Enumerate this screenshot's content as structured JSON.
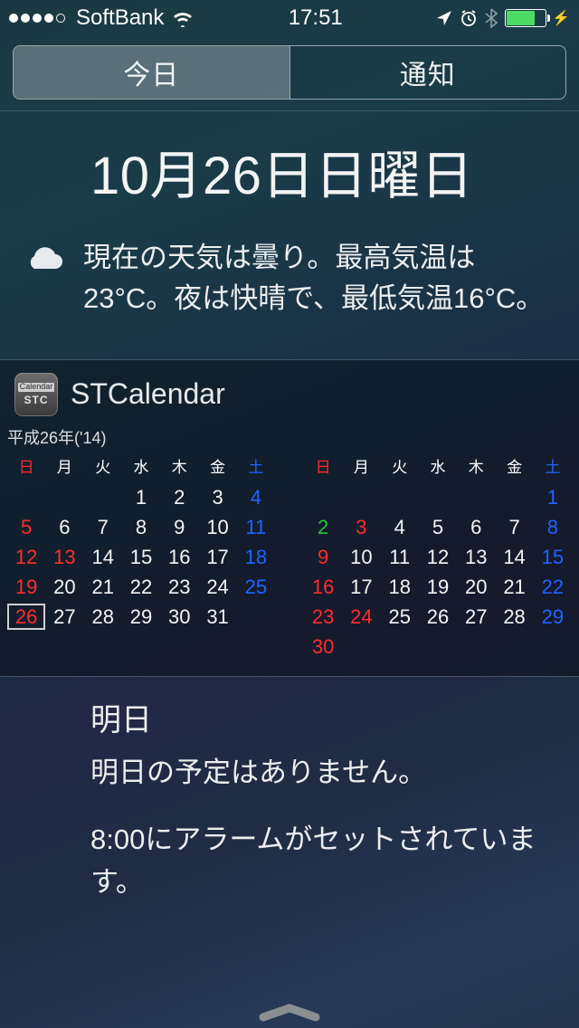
{
  "status": {
    "carrier": "SoftBank",
    "signal_filled": 4,
    "signal_total": 5,
    "time": "17:51"
  },
  "tabs": {
    "today": "今日",
    "notifications": "通知"
  },
  "date_heading": "10月26日日曜日",
  "weather": {
    "text": "現在の天気は曇り。最高気温は23°C。夜は快晴で、最低気温16°C。"
  },
  "widget": {
    "title": "STCalendar",
    "icon_line1": "Calendar",
    "icon_line2": "STC",
    "era": "平成26年('14)"
  },
  "dow": [
    "日",
    "月",
    "火",
    "水",
    "木",
    "金",
    "土"
  ],
  "month_left": {
    "first_weekday": 3,
    "days": 31,
    "today": 26,
    "sundays": [
      5,
      12,
      19,
      26
    ],
    "saturdays": [
      4,
      11,
      18,
      25
    ],
    "holidays": [
      13
    ]
  },
  "month_right": {
    "first_weekday": 6,
    "days": 30,
    "today": null,
    "sundays": [
      2,
      9,
      16,
      23,
      30
    ],
    "saturdays": [
      1,
      8,
      15,
      22,
      29
    ],
    "holidays": [
      3,
      23,
      24
    ],
    "greens": [
      2
    ]
  },
  "tomorrow": {
    "title": "明日",
    "no_events": "明日の予定はありません。",
    "alarm": "8:00にアラームがセットされています。"
  }
}
